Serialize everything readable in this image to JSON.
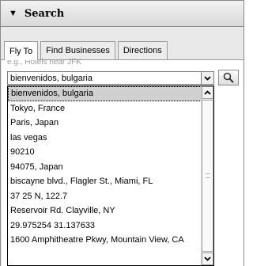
{
  "panel": {
    "title": "Search"
  },
  "tabs": [
    {
      "label": "Fly To",
      "active": true
    },
    {
      "label": "Find Businesses",
      "active": false
    },
    {
      "label": "Directions",
      "active": false
    }
  ],
  "search": {
    "hint": "e.g., Hotels near JFK",
    "value": "bienvenidos, bulgaria"
  },
  "dropdown": {
    "items": [
      "bienvenidos, bulgaria",
      "Tokyo, France",
      "Paris, Japan",
      "las vegas",
      "90210",
      "94075, Japan",
      "biscayne blvd., Flagler St., Miami, FL",
      "37 25 N, 122.7",
      "Reservoir Rd. Clayville, NY",
      "29.975254 31.137633",
      "1600 Amphitheatre Pkwy, Mountain View, CA"
    ],
    "selected_index": 0
  },
  "icons": {
    "collapse": "triangle-down-icon",
    "search": "magnifier-icon"
  }
}
